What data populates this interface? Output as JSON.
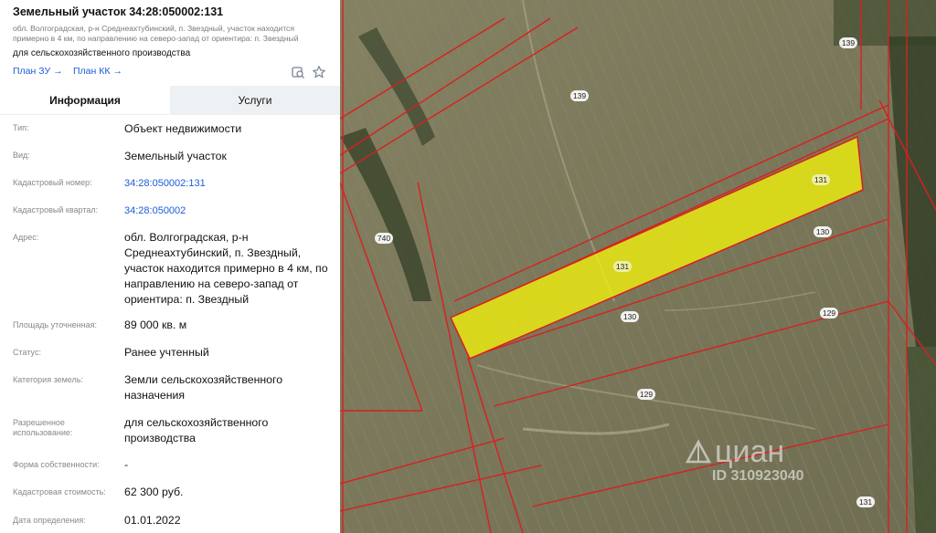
{
  "header": {
    "title": "Земельный участок 34:28:050002:131",
    "address": "обл. Волгоградская, р-н Среднеахтубинский, п. Звездный, участок находится примерно в 4 км, по направлению на северо-запад от ориентира: п. Звездный",
    "purpose": "для сельскохозяйственного производства",
    "plan_zu": "План ЗУ",
    "plan_kk": "План КК",
    "arrow": "→"
  },
  "tabs": [
    {
      "label": "Информация",
      "active": true
    },
    {
      "label": "Услуги",
      "active": false
    }
  ],
  "info": [
    {
      "key": "Тип:",
      "value": "Объект недвижимости"
    },
    {
      "key": "Вид:",
      "value": "Земельный участок"
    },
    {
      "key": "Кадастровый номер:",
      "value": "34:28:050002:131"
    },
    {
      "key": "Кадастровый квартал:",
      "value": "34:28:050002"
    },
    {
      "key": "Адрес:",
      "value": "обл. Волгоградская, р-н Среднеахтубинский, п. Звездный, участок находится примерно в 4 км, по направлению на северо-запад от ориентира: п. Звездный"
    },
    {
      "key": "Площадь уточненная:",
      "value": "89 000 кв. м"
    },
    {
      "key": "Статус:",
      "value": "Ранее учтенный"
    },
    {
      "key": "Категория земель:",
      "value": "Земли сельскохозяйственного назначения"
    },
    {
      "key": "Разрешенное использование:",
      "value": "для сельскохозяйственного производства"
    },
    {
      "key": "Форма собственности:",
      "value": "-"
    },
    {
      "key": "Кадастровая стоимость:",
      "value": "62 300 руб."
    },
    {
      "key": "Дата определения:",
      "value": "01.01.2022"
    }
  ],
  "map": {
    "parcel_labels": [
      "139",
      "139",
      "131",
      "131",
      "130",
      "130",
      "129",
      "129",
      "740",
      "131"
    ],
    "watermark_brand": "циан",
    "watermark_id": "ID 310923040",
    "colors": {
      "parcel_fill": "#f2f20c",
      "boundary": "#d82020",
      "field": "#7d7a5d"
    }
  }
}
